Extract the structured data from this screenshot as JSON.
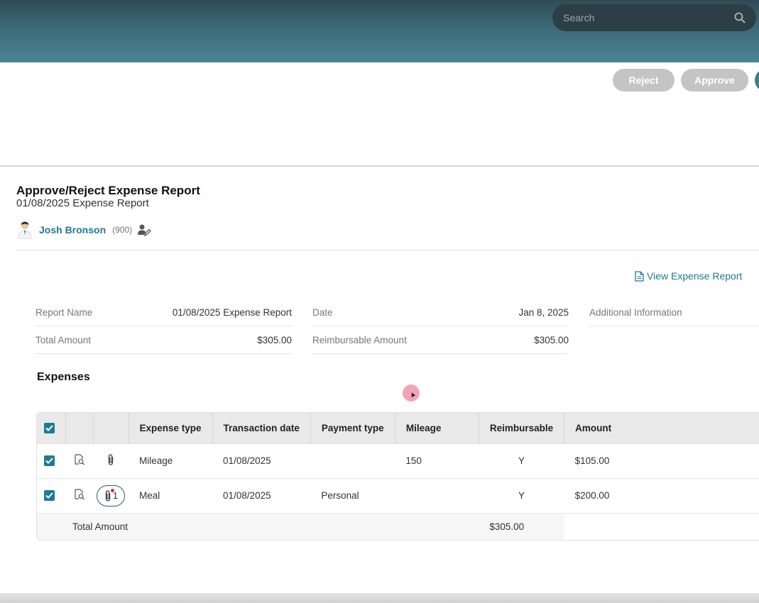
{
  "search": {
    "placeholder": "Search"
  },
  "actions": {
    "reject": "Reject",
    "approve": "Approve"
  },
  "page": {
    "title": "Approve/Reject Expense Report",
    "subtitle": "01/08/2025 Expense Report"
  },
  "user": {
    "name": "Josh Bronson",
    "id": "(900)"
  },
  "links": {
    "view_report": "View Expense Report"
  },
  "fields": [
    {
      "label": "Report Name",
      "value": "01/08/2025 Expense Report"
    },
    {
      "label": "Total Amount",
      "value": "$305.00"
    },
    {
      "label": "Date",
      "value": "Jan 8, 2025"
    },
    {
      "label": "Reimbursable Amount",
      "value": "$305.00"
    },
    {
      "label": "Additional Information",
      "value": ""
    }
  ],
  "expenses": {
    "title": "Expenses",
    "columns": [
      "Expense type",
      "Transaction date",
      "Payment type",
      "Mileage",
      "Reimbursable",
      "Amount"
    ],
    "rows": [
      {
        "expense_type": "Mileage",
        "transaction_date": "01/08/2025",
        "payment_type": "",
        "mileage": "150",
        "reimbursable": "Y",
        "amount": "$105.00"
      },
      {
        "expense_type": "Meal",
        "transaction_date": "01/08/2025",
        "payment_type": "Personal",
        "mileage": "",
        "reimbursable": "Y",
        "amount": "$200.00",
        "attachment_count": "1"
      }
    ],
    "total_label": "Total Amount",
    "total_value": "$305.00"
  },
  "colors": {
    "accent": "#1f7a93",
    "header_bar": "#3d6a78",
    "button_disabled": "#c4c4c4"
  }
}
